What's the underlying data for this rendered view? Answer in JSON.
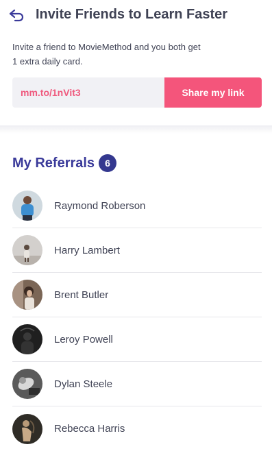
{
  "header": {
    "title": "Invite Friends to Learn Faster",
    "back_icon": "back-arrow-icon"
  },
  "invite": {
    "description": "Invite a friend to MovieMethod  and you both get\n1 extra daily card.",
    "link_value": "mm.to/1nVit3",
    "share_label": "Share my link"
  },
  "referrals": {
    "title": "My Referrals",
    "count": "6",
    "items": [
      {
        "name": "Raymond Roberson",
        "avatar_bg": "#8fb3c9"
      },
      {
        "name": "Harry Lambert",
        "avatar_bg": "#c7c4c2"
      },
      {
        "name": "Brent Butler",
        "avatar_bg": "#6b5a4e"
      },
      {
        "name": "Leroy Powell",
        "avatar_bg": "#2a2a2a"
      },
      {
        "name": "Dylan Steele",
        "avatar_bg": "#4a4a4a"
      },
      {
        "name": "Rebecca Harris",
        "avatar_bg": "#3d3a33"
      }
    ]
  },
  "colors": {
    "accent_pink": "#f4557b",
    "link_text": "#ef5a7e",
    "heading_blue": "#3a3a9a",
    "badge_blue": "#34388f"
  }
}
